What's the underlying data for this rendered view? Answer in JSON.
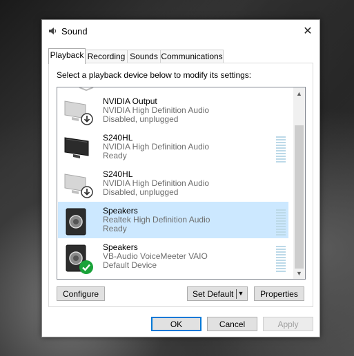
{
  "window": {
    "title": "Sound",
    "icon": "speaker-icon",
    "close_glyph": "✕"
  },
  "tabs": [
    {
      "label": "Playback",
      "active": true
    },
    {
      "label": "Recording",
      "active": false
    },
    {
      "label": "Sounds",
      "active": false
    },
    {
      "label": "Communications",
      "active": false
    }
  ],
  "instruction": "Select a playback device below to modify its settings:",
  "devices": [
    {
      "name": "NVIDIA Output",
      "driver": "NVIDIA High Definition Audio",
      "status": "Disabled, unplugged",
      "icon": "monitor-disabled-icon",
      "badge": "down-arrow"
    },
    {
      "name": "S240HL",
      "driver": "NVIDIA High Definition Audio",
      "status": "Ready",
      "icon": "monitor-icon",
      "badge": "none"
    },
    {
      "name": "S240HL",
      "driver": "NVIDIA High Definition Audio",
      "status": "Disabled, unplugged",
      "icon": "monitor-disabled-icon",
      "badge": "down-arrow"
    },
    {
      "name": "Speakers",
      "driver": "Realtek High Definition Audio",
      "status": "Ready",
      "icon": "speaker-box-icon",
      "badge": "none",
      "selected": true
    },
    {
      "name": "Speakers",
      "driver": "VB-Audio VoiceMeeter VAIO",
      "status": "Default Device",
      "icon": "speaker-box-icon",
      "badge": "green-check"
    }
  ],
  "buttons": {
    "configure": "Configure",
    "set_default": "Set Default",
    "properties": "Properties",
    "ok": "OK",
    "cancel": "Cancel",
    "apply": "Apply"
  },
  "glyphs": {
    "scroll_up": "▲",
    "scroll_down": "▼",
    "dropdown": "▼"
  },
  "colors": {
    "selection": "#cce8ff",
    "default_check": "#1aa33a",
    "focus_border": "#0078d7"
  }
}
